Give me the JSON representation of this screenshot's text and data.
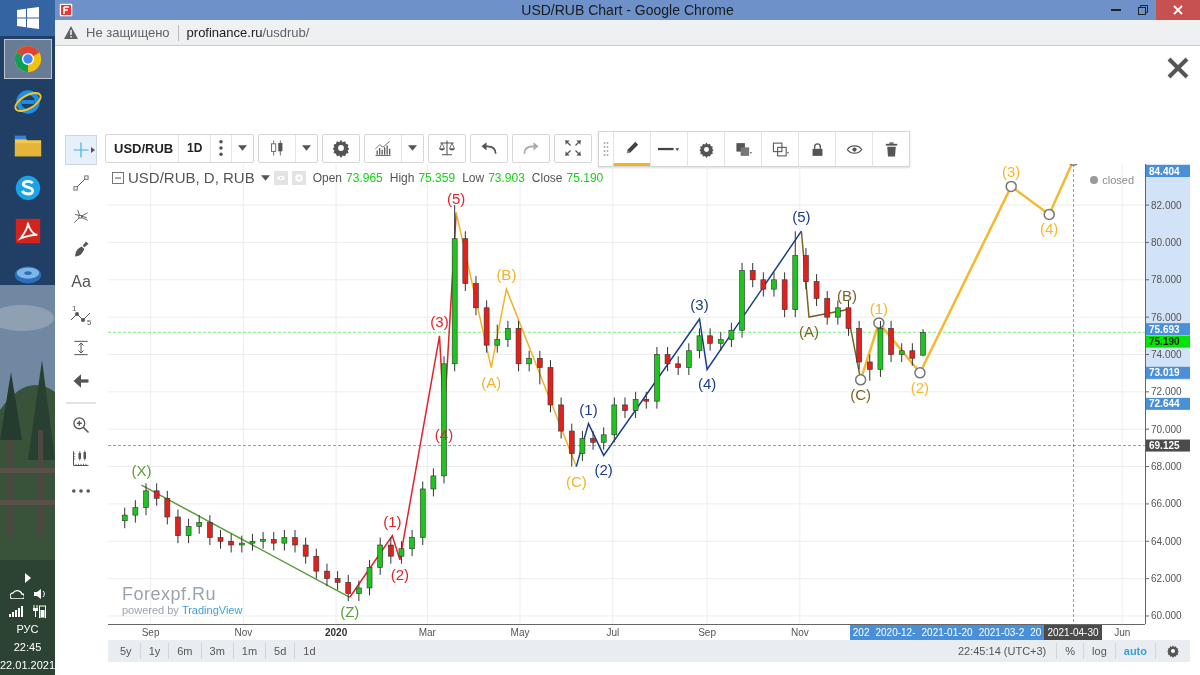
{
  "taskbar": {
    "apps": [
      {
        "kind": "chrome",
        "selected": true
      },
      {
        "kind": "ie",
        "selected": false
      },
      {
        "kind": "files",
        "selected": false
      },
      {
        "kind": "skype",
        "selected": false
      },
      {
        "kind": "pdf",
        "selected": false
      },
      {
        "kind": "disc",
        "selected": false
      }
    ],
    "tray": {
      "language": "РУС",
      "time": "22:45",
      "date": "22.01.2021"
    }
  },
  "browser": {
    "title": "USD/RUB Chart - Google Chrome",
    "security": "Не защищено",
    "url_host": "profinance.ru",
    "url_path": "/usdrub/"
  },
  "left_tools": [
    {
      "kind": "crosshair",
      "selected": true
    },
    {
      "kind": "trend-line",
      "selected": false
    },
    {
      "kind": "pitchfork",
      "selected": false
    },
    {
      "kind": "brush",
      "selected": false
    },
    {
      "kind": "text",
      "label": "Aa",
      "selected": false
    },
    {
      "kind": "wave",
      "digits": [
        "1",
        "5"
      ],
      "selected": false
    },
    {
      "kind": "measure",
      "selected": false
    },
    {
      "kind": "arrow",
      "selected": false
    },
    {
      "kind": "zoom",
      "selected": false
    },
    {
      "kind": "ruler",
      "selected": false
    },
    {
      "kind": "more",
      "selected": false
    }
  ],
  "toolbar": {
    "symbol": "USD/RUB",
    "interval": "1D",
    "buttons": [
      {
        "kind": "more",
        "dropdown": true
      },
      {
        "kind": "candles",
        "dropdown": true
      },
      {
        "kind": "settings",
        "dropdown": false
      },
      {
        "kind": "indicators",
        "dropdown": true
      },
      {
        "kind": "compare",
        "dropdown": false
      },
      {
        "kind": "undo",
        "dropdown": false
      },
      {
        "kind": "redo",
        "dropdown": false
      },
      {
        "kind": "fullscreen",
        "dropdown": false
      }
    ]
  },
  "drawing_toolbar": [
    {
      "kind": "pencil",
      "selected": true
    },
    {
      "kind": "line-style",
      "selected": false
    },
    {
      "kind": "settings",
      "selected": false
    },
    {
      "kind": "fill",
      "selected": false
    },
    {
      "kind": "border",
      "selected": false
    },
    {
      "kind": "lock",
      "selected": false
    },
    {
      "kind": "visibility",
      "selected": false
    },
    {
      "kind": "delete",
      "selected": false
    }
  ],
  "legend": {
    "values": [
      {
        "label": "Open",
        "value": "73.965"
      },
      {
        "label": "High",
        "value": "75.359"
      },
      {
        "label": "Low",
        "value": "73.903"
      },
      {
        "label": "Close",
        "value": "75.190"
      }
    ],
    "status": "closed"
  },
  "chart_data": {
    "type": "candlestick",
    "title": "USD/RUB, D, RUB",
    "grid": true,
    "x": [
      "2019-08-15",
      "2019-08-22",
      "2019-08-29",
      "2019-09-05",
      "2019-09-12",
      "2019-09-19",
      "2019-09-26",
      "2019-10-03",
      "2019-10-10",
      "2019-10-17",
      "2019-10-24",
      "2019-10-31",
      "2019-11-07",
      "2019-11-14",
      "2019-11-21",
      "2019-11-28",
      "2019-12-05",
      "2019-12-12",
      "2019-12-19",
      "2019-12-26",
      "2020-01-02",
      "2020-01-09",
      "2020-01-16",
      "2020-01-23",
      "2020-01-30",
      "2020-02-06",
      "2020-02-13",
      "2020-02-20",
      "2020-02-27",
      "2020-03-05",
      "2020-03-12",
      "2020-03-19",
      "2020-03-26",
      "2020-04-02",
      "2020-04-09",
      "2020-04-16",
      "2020-04-23",
      "2020-04-30",
      "2020-05-07",
      "2020-05-14",
      "2020-05-21",
      "2020-05-28",
      "2020-06-04",
      "2020-06-11",
      "2020-06-18",
      "2020-06-25",
      "2020-07-02",
      "2020-07-09",
      "2020-07-16",
      "2020-07-23",
      "2020-07-30",
      "2020-08-06",
      "2020-08-13",
      "2020-08-20",
      "2020-08-27",
      "2020-09-03",
      "2020-09-10",
      "2020-09-17",
      "2020-09-24",
      "2020-10-01",
      "2020-10-08",
      "2020-10-15",
      "2020-10-22",
      "2020-10-29",
      "2020-11-05",
      "2020-11-12",
      "2020-11-19",
      "2020-11-26",
      "2020-12-03",
      "2020-12-10",
      "2020-12-17",
      "2020-12-24",
      "2020-12-31",
      "2021-01-07",
      "2021-01-14",
      "2021-01-21"
    ],
    "ohlc": [
      [
        65.1,
        65.8,
        64.7,
        65.4
      ],
      [
        65.4,
        66.2,
        65.0,
        65.8
      ],
      [
        65.8,
        67.1,
        65.4,
        66.7
      ],
      [
        66.7,
        67.1,
        65.9,
        66.3
      ],
      [
        66.3,
        66.7,
        64.9,
        65.3
      ],
      [
        65.3,
        65.7,
        63.9,
        64.3
      ],
      [
        64.3,
        65.2,
        63.9,
        64.8
      ],
      [
        64.8,
        65.4,
        64.4,
        65.0
      ],
      [
        65.0,
        65.4,
        63.8,
        64.2
      ],
      [
        64.2,
        64.6,
        63.6,
        64.0
      ],
      [
        64.0,
        64.4,
        63.4,
        63.8
      ],
      [
        63.8,
        64.3,
        63.4,
        63.9
      ],
      [
        63.9,
        64.4,
        63.5,
        64.0
      ],
      [
        64.0,
        64.5,
        63.6,
        64.1
      ],
      [
        64.1,
        64.5,
        63.5,
        63.9
      ],
      [
        63.9,
        64.6,
        63.5,
        64.2
      ],
      [
        64.2,
        64.6,
        63.4,
        63.8
      ],
      [
        63.8,
        64.2,
        62.8,
        63.2
      ],
      [
        63.2,
        63.6,
        62.0,
        62.4
      ],
      [
        62.4,
        62.8,
        61.6,
        62.0
      ],
      [
        62.0,
        62.4,
        61.4,
        61.8
      ],
      [
        61.8,
        62.2,
        60.8,
        61.2
      ],
      [
        61.2,
        61.9,
        60.8,
        61.5
      ],
      [
        61.5,
        63.0,
        61.1,
        62.6
      ],
      [
        62.6,
        64.2,
        62.2,
        63.8
      ],
      [
        63.8,
        64.2,
        62.8,
        63.2
      ],
      [
        63.2,
        64.0,
        62.8,
        63.6
      ],
      [
        63.6,
        64.6,
        63.2,
        64.2
      ],
      [
        64.2,
        67.2,
        63.8,
        66.8
      ],
      [
        66.8,
        67.9,
        66.4,
        67.5
      ],
      [
        67.5,
        73.9,
        67.1,
        73.5
      ],
      [
        73.5,
        82.0,
        73.1,
        80.2
      ],
      [
        80.2,
        80.6,
        77.4,
        77.8
      ],
      [
        77.8,
        78.2,
        76.1,
        76.5
      ],
      [
        76.5,
        76.9,
        74.1,
        74.5
      ],
      [
        74.5,
        75.6,
        74.1,
        74.8
      ],
      [
        74.8,
        75.8,
        74.4,
        75.4
      ],
      [
        75.4,
        75.8,
        73.1,
        73.5
      ],
      [
        73.5,
        74.2,
        73.1,
        73.8
      ],
      [
        73.8,
        74.2,
        72.4,
        73.3
      ],
      [
        73.3,
        73.7,
        70.9,
        71.3
      ],
      [
        71.3,
        71.7,
        69.5,
        69.9
      ],
      [
        69.9,
        70.3,
        68.0,
        68.7
      ],
      [
        68.7,
        69.9,
        68.3,
        69.5
      ],
      [
        69.5,
        69.9,
        68.9,
        69.3
      ],
      [
        69.3,
        70.1,
        68.9,
        69.7
      ],
      [
        69.7,
        71.7,
        69.3,
        71.3
      ],
      [
        71.3,
        71.7,
        70.6,
        71.0
      ],
      [
        71.0,
        72.0,
        70.6,
        71.6
      ],
      [
        71.6,
        72.0,
        71.1,
        71.5
      ],
      [
        71.5,
        74.4,
        71.1,
        74.0
      ],
      [
        74.0,
        74.4,
        73.1,
        73.5
      ],
      [
        73.5,
        73.9,
        72.9,
        73.3
      ],
      [
        73.3,
        74.6,
        72.9,
        74.2
      ],
      [
        74.2,
        75.4,
        73.8,
        75.0
      ],
      [
        75.0,
        75.4,
        74.2,
        74.6
      ],
      [
        74.6,
        75.2,
        74.2,
        74.8
      ],
      [
        74.8,
        75.7,
        74.4,
        75.3
      ],
      [
        75.3,
        78.9,
        74.9,
        78.5
      ],
      [
        78.5,
        78.9,
        77.6,
        78.0
      ],
      [
        78.0,
        78.4,
        77.1,
        77.5
      ],
      [
        77.5,
        78.4,
        77.1,
        78.0
      ],
      [
        78.0,
        78.4,
        76.0,
        76.4
      ],
      [
        76.4,
        80.6,
        76.0,
        79.3
      ],
      [
        79.3,
        79.7,
        77.5,
        77.9
      ],
      [
        77.9,
        78.3,
        76.6,
        77.0
      ],
      [
        77.0,
        77.4,
        75.6,
        76.0
      ],
      [
        76.0,
        76.9,
        75.6,
        76.5
      ],
      [
        76.5,
        76.9,
        75.0,
        75.4
      ],
      [
        75.4,
        75.8,
        73.2,
        73.6
      ],
      [
        73.6,
        74.0,
        72.6,
        73.2
      ],
      [
        73.2,
        75.8,
        72.8,
        75.4
      ],
      [
        75.4,
        75.8,
        73.6,
        74.0
      ],
      [
        74.0,
        74.6,
        73.6,
        74.2
      ],
      [
        74.2,
        74.6,
        73.4,
        73.8
      ],
      [
        73.965,
        75.359,
        73.903,
        75.19
      ]
    ],
    "xlim": [
      "2019-08-04",
      "2021-06-16"
    ],
    "ylim": [
      59.57,
      84.2
    ],
    "xticks": [
      {
        "value": "2019-09-01",
        "label": "Sep"
      },
      {
        "value": "2019-11-01",
        "label": "Nov"
      },
      {
        "value": "2020-01-01",
        "label": "2020"
      },
      {
        "value": "2020-03-01",
        "label": "Mar"
      },
      {
        "value": "2020-05-01",
        "label": "May"
      },
      {
        "value": "2020-07-01",
        "label": "Jul"
      },
      {
        "value": "2020-09-01",
        "label": "Sep"
      },
      {
        "value": "2020-11-01",
        "label": "Nov"
      },
      {
        "value": "2021-06-01",
        "label": "Jun"
      }
    ],
    "yticks": [
      {
        "value": 60,
        "label": "60.000"
      },
      {
        "value": 62,
        "label": "62.000"
      },
      {
        "value": 64,
        "label": "64.000"
      },
      {
        "value": 66,
        "label": "66.000"
      },
      {
        "value": 68,
        "label": "68.000"
      },
      {
        "value": 70,
        "label": "70.000"
      },
      {
        "value": 72,
        "label": "72.000"
      },
      {
        "value": 74,
        "label": "74.000"
      },
      {
        "value": 76,
        "label": "76.000"
      },
      {
        "value": 78,
        "label": "78.000"
      },
      {
        "value": 80,
        "label": "80.000"
      },
      {
        "value": 82,
        "label": "82.000"
      }
    ],
    "ref_lines": [
      {
        "axis": "y",
        "value": 75.19,
        "label": "75.190",
        "color": "#00e600"
      },
      {
        "axis": "y",
        "value": 69.125,
        "label": "69.125",
        "color": "#4b4b4b"
      },
      {
        "axis": "x",
        "value": "2021-04-30",
        "label": "2021-04-30",
        "color": "#4b4b4b"
      }
    ]
  },
  "waves": [
    {
      "kind": "wave",
      "color": "#5a9e3a",
      "labels": [
        "(X)",
        "(Z)"
      ]
    },
    {
      "kind": "wave",
      "color": "#e0242b",
      "labels": [
        "(1)",
        "(2)",
        "(3)",
        "(4)",
        "(5)"
      ]
    },
    {
      "kind": "wave",
      "color": "#f0b429",
      "labels": [
        "(A)",
        "(B)",
        "(C)"
      ]
    },
    {
      "kind": "wave",
      "color": "#1b3f8b",
      "labels": [
        "(1)",
        "(2)",
        "(3)",
        "(4)",
        "(5)"
      ]
    },
    {
      "kind": "wave",
      "color": "#7d6327",
      "labels": [
        "(A)",
        "(B)",
        "(C)"
      ]
    },
    {
      "kind": "forecast",
      "color": "#f5b82e",
      "labels": [
        "(1)",
        "(2)",
        "(3)",
        "(4)"
      ]
    }
  ],
  "price_markers": [
    "84.404",
    "75.693",
    "73.019",
    "72.644"
  ],
  "time_markers": [
    "202",
    "2020-12-",
    "2021-01-20",
    "2021-03-2",
    "20"
  ],
  "branding": {
    "brand": "Forexpf.Ru",
    "powered_by": "powered by",
    "provider": "TradingView"
  },
  "bottom_bar": {
    "ranges": [
      "5y",
      "1y",
      "6m",
      "3m",
      "1m",
      "5d",
      "1d"
    ],
    "clock": "22:45:14 (UTC+3)",
    "scale_options": [
      {
        "label": "%",
        "selected": false
      },
      {
        "label": "log",
        "selected": false
      },
      {
        "label": "auto",
        "selected": true
      }
    ]
  }
}
